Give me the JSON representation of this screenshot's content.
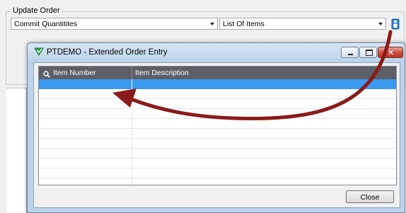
{
  "update_group": {
    "title": "Update Order"
  },
  "commit_combo": {
    "value": "Commit Quantitites"
  },
  "items_combo": {
    "value": "List Of Items"
  },
  "dialog": {
    "title": "PTDEMO - Extended Order Entry",
    "columns": [
      "Item Number",
      "Item Description"
    ],
    "rows": 12,
    "selected_row": 0,
    "close_label": "Close"
  },
  "colors": {
    "selection": "#3c99f0",
    "header": "#5c5f66",
    "annotation_arrow": "#8b1a1a"
  },
  "icons": [
    "chevron-down-icon",
    "info-icon",
    "search-icon",
    "app-checkmark-icon",
    "minimize-icon",
    "maximize-icon",
    "close-icon"
  ]
}
